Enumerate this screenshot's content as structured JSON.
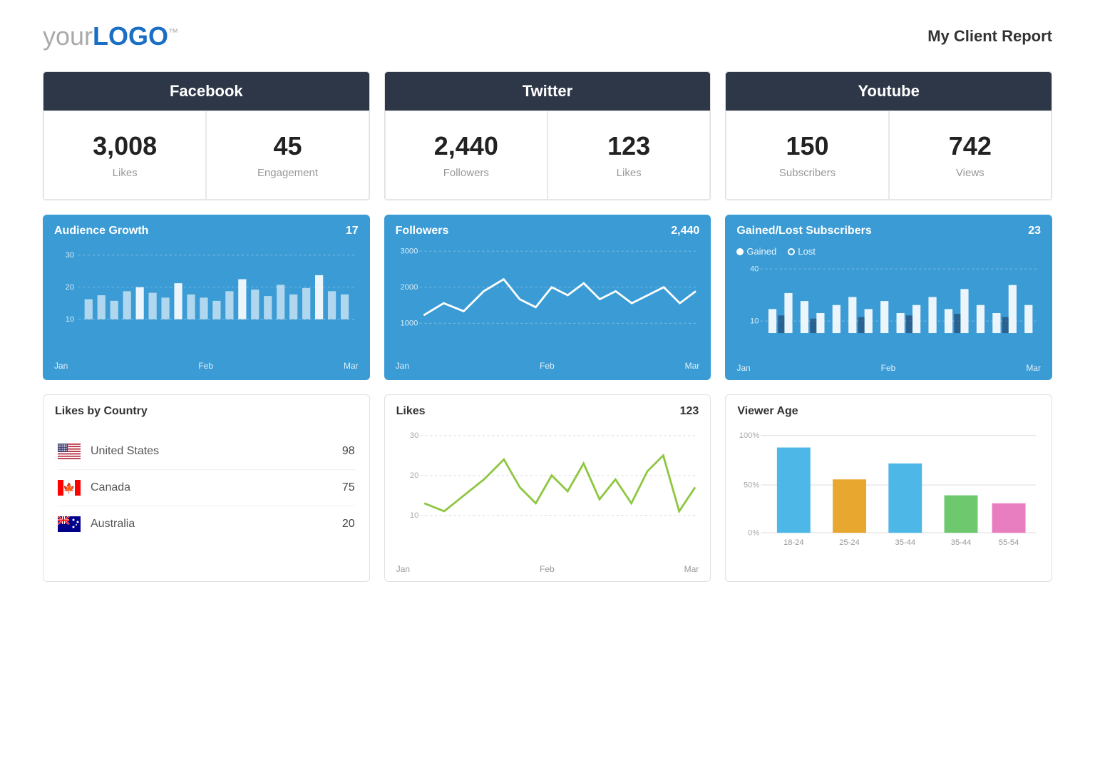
{
  "header": {
    "logo_text": "your",
    "logo_bold": "LOGO",
    "logo_tm": "™",
    "report_title": "My Client Report"
  },
  "platforms": {
    "facebook": {
      "label": "Facebook",
      "stat1_value": "3,008",
      "stat1_label": "Likes",
      "stat2_value": "45",
      "stat2_label": "Engagement"
    },
    "twitter": {
      "label": "Twitter",
      "stat1_value": "2,440",
      "stat1_label": "Followers",
      "stat2_value": "123",
      "stat2_label": "Likes"
    },
    "youtube": {
      "label": "Youtube",
      "stat1_value": "150",
      "stat1_label": "Subscribers",
      "stat2_value": "742",
      "stat2_label": "Views"
    }
  },
  "charts": {
    "audience_growth": {
      "title": "Audience Growth",
      "value": "17",
      "axis_labels": [
        "Jan",
        "Feb",
        "Mar"
      ],
      "y_labels": [
        "30",
        "20",
        "10"
      ]
    },
    "followers": {
      "title": "Followers",
      "value": "2,440",
      "axis_labels": [
        "Jan",
        "Feb",
        "Mar"
      ],
      "y_labels": [
        "3000",
        "2000",
        "1000"
      ]
    },
    "gained_lost": {
      "title": "Gained/Lost Subscribers",
      "value": "23",
      "legend": [
        "Gained",
        "Lost"
      ],
      "axis_labels": [
        "Jan",
        "Feb",
        "Mar"
      ],
      "y_labels": [
        "40",
        "10"
      ]
    },
    "likes_by_country": {
      "title": "Likes by Country",
      "countries": [
        {
          "name": "United States",
          "count": 98,
          "flag": "us"
        },
        {
          "name": "Canada",
          "count": 75,
          "flag": "ca"
        },
        {
          "name": "Australia",
          "count": 20,
          "flag": "au"
        }
      ]
    },
    "likes": {
      "title": "Likes",
      "value": "123",
      "axis_labels": [
        "Jan",
        "Feb",
        "Mar"
      ],
      "y_labels": [
        "30",
        "20",
        "10"
      ]
    },
    "viewer_age": {
      "title": "Viewer Age",
      "age_groups": [
        "18-24",
        "25-24",
        "35-44",
        "35-44",
        "55-54"
      ],
      "colors": [
        "#4db8e8",
        "#e8a830",
        "#4db8e8",
        "#6ec96e",
        "#e87ec0"
      ],
      "y_labels": [
        "100%",
        "50%",
        "0%"
      ]
    }
  }
}
